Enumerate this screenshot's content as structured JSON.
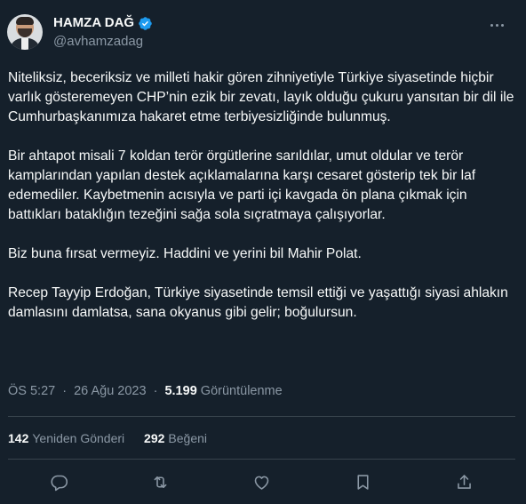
{
  "author": {
    "display_name": "HAMZA DAĞ",
    "handle": "@avhamzadag",
    "verified": true,
    "avatar_icon": "profile-photo"
  },
  "tweet": {
    "paragraphs": [
      "Niteliksiz, beceriksiz ve milleti hakir gören zihniyetiyle Türkiye siyasetinde hiçbir varlık gösteremeyen CHP’nin ezik bir zevatı, layık olduğu çukuru yansıtan bir dil ile Cumhurbaşkanımıza hakaret etme terbiyesizliğinde bulunmuş.",
      "Bir ahtapot misali 7 koldan terör örgütlerine sarıldılar, umut oldular ve terör kamplarından yapılan destek açıklamalarına karşı cesaret gösterip tek bir laf edemediler. Kaybetmenin acısıyla ve parti içi kavgada ön plana çıkmak için battıkları bataklığın tezeğini sağa sola sıçratmaya çalışıyorlar.",
      "Biz buna fırsat vermeyiz. Haddini ve yerini bil Mahir Polat.",
      "Recep Tayyip Erdoğan, Türkiye siyasetinde temsil ettiği ve yaşattığı siyasi ahlakın damlasını damlatsa, sana okyanus gibi gelir; boğulursun."
    ]
  },
  "meta": {
    "time": "ÖS 5:27",
    "separator": "·",
    "date": "26 Ağu 2023",
    "views_count": "5.199",
    "views_label": "Görüntülenme"
  },
  "stats": {
    "retweets_count": "142",
    "retweets_label": "Yeniden Gönderi",
    "likes_count": "292",
    "likes_label": "Beğeni"
  },
  "actions": [
    "reply-icon",
    "retweet-icon",
    "like-icon",
    "bookmark-icon",
    "share-icon"
  ],
  "colors": {
    "background": "#15202b",
    "text": "#f7f9f9",
    "secondary": "#8b98a5",
    "divider": "#38444d",
    "verified": "#1d9bf0"
  }
}
